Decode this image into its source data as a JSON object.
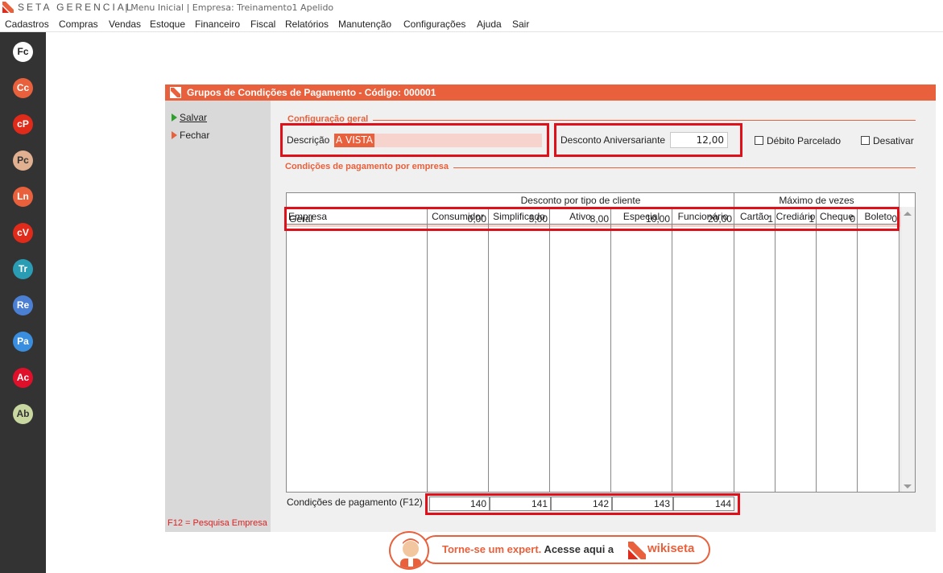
{
  "app": {
    "brand": "SETA GERENCIAL",
    "context": "| Menu Inicial | Empresa: Treinamento1 Apelido"
  },
  "menu": [
    "Cadastros",
    "Compras",
    "Vendas",
    "Estoque",
    "Financeiro",
    "Fiscal",
    "Relatórios",
    "Manutenção",
    "Configurações",
    "Ajuda",
    "Sair"
  ],
  "sidebar": [
    {
      "label": "Fc",
      "color": "#ffffff",
      "text": "#222222"
    },
    {
      "label": "Cc",
      "color": "#e8603c",
      "text": "#ffffff"
    },
    {
      "label": "cP",
      "color": "#e02a1a",
      "text": "#ffffff"
    },
    {
      "label": "Pc",
      "color": "#e0b090",
      "text": "#333333"
    },
    {
      "label": "Ln",
      "color": "#e8603c",
      "text": "#ffffff"
    },
    {
      "label": "cV",
      "color": "#e02a1a",
      "text": "#ffffff"
    },
    {
      "label": "Tr",
      "color": "#2a9db5",
      "text": "#ffffff"
    },
    {
      "label": "Re",
      "color": "#4a7fd4",
      "text": "#ffffff"
    },
    {
      "label": "Pa",
      "color": "#3a8ee0",
      "text": "#ffffff"
    },
    {
      "label": "Ac",
      "color": "#e0102a",
      "text": "#ffffff"
    },
    {
      "label": "Ab",
      "color": "#c8d8a0",
      "text": "#333333"
    }
  ],
  "window": {
    "title": "Grupos de Condições de Pagamento - Código: 000001",
    "actions": {
      "save": "Salvar",
      "close": "Fechar"
    },
    "f12_note": "F12 = Pesquisa Empresa",
    "general_section": "Configuração geral",
    "description_label": "Descrição",
    "description_value": "A VISTA",
    "birthday_discount_label": "Desconto Aniversariante",
    "birthday_discount_value": "12,00",
    "debit_installment_label": "Débito Parcelado",
    "deactivate_label": "Desativar",
    "company_section": "Condições de pagamento por empresa"
  },
  "grid": {
    "group_headers": {
      "discount": "Desconto por tipo de cliente",
      "max_times": "Máximo de vezes"
    },
    "columns": [
      "Empresa",
      "Consumidor",
      "Simplificado",
      "Ativo",
      "Especial",
      "Funcionário",
      "Cartão",
      "Crediário",
      "Cheque",
      "Boleto"
    ],
    "rows": [
      [
        "Geral",
        "0,00",
        "5,00",
        "8,00",
        "10,00",
        "20,00",
        "1",
        "1",
        "0",
        "0"
      ]
    ]
  },
  "summary": {
    "label": "Condições de pagamento (F12)",
    "values": [
      "140",
      "141",
      "142",
      "143",
      "144"
    ]
  },
  "banner": {
    "text1": "Torne-se um expert.",
    "text2": "Acesse aqui a",
    "brand": "wikiseta"
  }
}
